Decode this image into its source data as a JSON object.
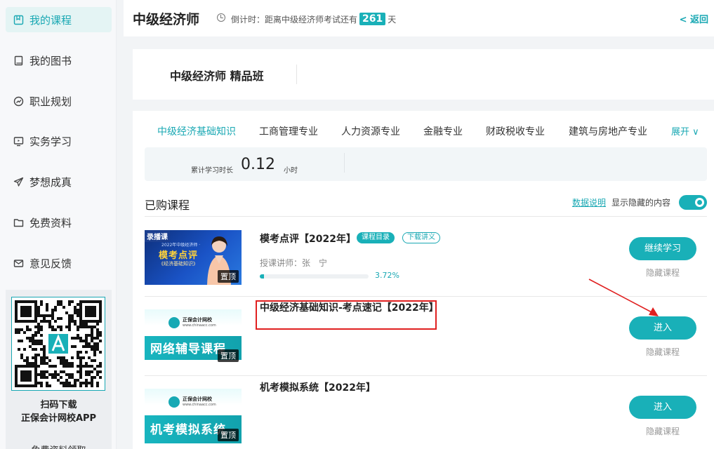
{
  "sidebar": {
    "items": [
      {
        "label": "我的课程",
        "icon": "course-icon",
        "active": true
      },
      {
        "label": "我的图书",
        "icon": "book-icon",
        "active": false
      },
      {
        "label": "职业规划",
        "icon": "compass-icon",
        "active": false
      },
      {
        "label": "实务学习",
        "icon": "monitor-icon",
        "active": false
      },
      {
        "label": "梦想成真",
        "icon": "paper-plane-icon",
        "active": false
      },
      {
        "label": "免费资料",
        "icon": "folder-icon",
        "active": false
      },
      {
        "label": "意见反馈",
        "icon": "mail-icon",
        "active": false
      }
    ],
    "qr": {
      "caption_line1": "扫码下载",
      "caption_line2": "正保会计网校APP",
      "bottom_link": "免费资料领取"
    }
  },
  "header": {
    "title": "中级经济师",
    "countdown_prefix": "倒计时：距离中级经济师考试还有",
    "days": "261",
    "countdown_suffix": "天",
    "back_label": "< 返回"
  },
  "class_card": {
    "name": "中级经济师 精品班"
  },
  "tabs": {
    "items": [
      {
        "label": "中级经济基础知识",
        "active": true
      },
      {
        "label": "工商管理专业",
        "active": false
      },
      {
        "label": "人力资源专业",
        "active": false
      },
      {
        "label": "金融专业",
        "active": false
      },
      {
        "label": "财政税收专业",
        "active": false
      },
      {
        "label": "建筑与房地产专业",
        "active": false
      }
    ],
    "expand_label": "展开 ∨"
  },
  "stats": {
    "label": "累计学习时长",
    "value": "0.12",
    "unit": "小时"
  },
  "purchased": {
    "title": "已购课程",
    "data_link": "数据说明",
    "show_hidden_label": "显示隐藏的内容",
    "show_hidden_on": true
  },
  "courses": [
    {
      "title": "模考点评【2022年】",
      "chip_catalog": "课程目录",
      "chip_download": "下载讲义",
      "teacher": "授课讲师：张　宁",
      "progress": 3.72,
      "progress_label": "3.72%",
      "button": "继续学习",
      "hide": "隐藏课程",
      "thumb": {
        "badge": "录播课",
        "line1": "2022年中级经济师 ·",
        "line2": "模考点评",
        "line3": "《经济基础知识》",
        "pin": "置顶"
      }
    },
    {
      "title": "中级经济基础知识-考点速记【2022年】",
      "button": "进入",
      "hide": "隐藏课程",
      "thumb": {
        "school": "正保会计网校",
        "url": "www.chinaacc.com",
        "big": "网络辅导课程",
        "pin": "置顶"
      }
    },
    {
      "title": "机考模拟系统【2022年】",
      "button": "进入",
      "hide": "隐藏课程",
      "thumb": {
        "school": "正保会计网校",
        "url": "www.chinaacc.com",
        "big": "机考模拟系统",
        "pin": "置顶"
      }
    }
  ],
  "colors": {
    "accent": "#19b0b8",
    "annotation": "#e02020"
  }
}
